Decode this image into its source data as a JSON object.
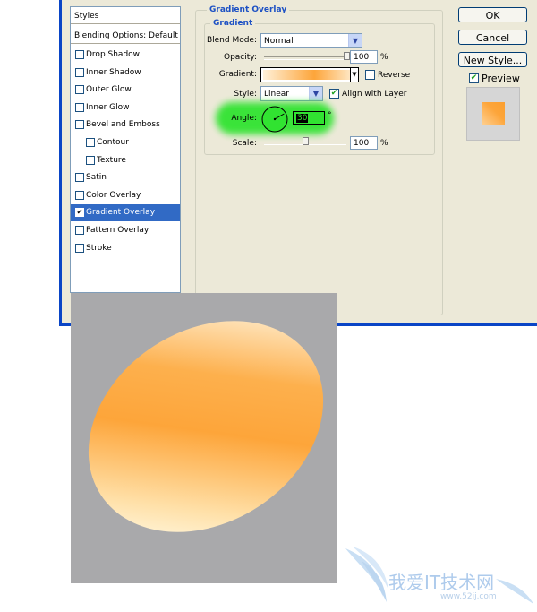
{
  "styles_panel": {
    "header": "Styles",
    "blending_options": "Blending Options: Default",
    "items": [
      {
        "label": "Drop Shadow",
        "checked": false
      },
      {
        "label": "Inner Shadow",
        "checked": false
      },
      {
        "label": "Outer Glow",
        "checked": false
      },
      {
        "label": "Inner Glow",
        "checked": false
      },
      {
        "label": "Bevel and Emboss",
        "checked": false
      },
      {
        "label": "Contour",
        "checked": false
      },
      {
        "label": "Texture",
        "checked": false
      },
      {
        "label": "Satin",
        "checked": false
      },
      {
        "label": "Color Overlay",
        "checked": false
      },
      {
        "label": "Gradient Overlay",
        "checked": true,
        "selected": true
      },
      {
        "label": "Pattern Overlay",
        "checked": false
      },
      {
        "label": "Stroke",
        "checked": false
      }
    ]
  },
  "gradient_overlay": {
    "group_title": "Gradient Overlay",
    "subgroup_title": "Gradient",
    "blend_mode_label": "Blend Mode:",
    "blend_mode_value": "Normal",
    "opacity_label": "Opacity:",
    "opacity_value": "100",
    "opacity_unit": "%",
    "gradient_label": "Gradient:",
    "reverse_label": "Reverse",
    "style_label": "Style:",
    "style_value": "Linear",
    "align_label": "Align with Layer",
    "angle_label": "Angle:",
    "angle_value": "30",
    "angle_unit": "°",
    "scale_label": "Scale:",
    "scale_value": "100",
    "scale_unit": "%"
  },
  "buttons": {
    "ok": "OK",
    "cancel": "Cancel",
    "new_style": "New Style...",
    "preview_label": "Preview"
  },
  "watermark": {
    "site_name": "我爱IT技术网",
    "url": "www.52ij.com"
  },
  "colors": {
    "dialog_bg": "#ece9d8",
    "selection": "#316ac5",
    "group_title": "#1d51c4",
    "gradient_orange": "#fda53a",
    "gradient_light": "#fff2d6",
    "angle_highlight": "#31e331",
    "canvas_gray": "#a9a9ab"
  }
}
